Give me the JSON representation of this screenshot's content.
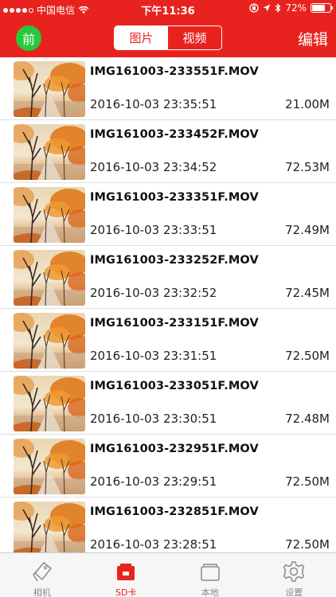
{
  "status_bar": {
    "carrier": "中国电信",
    "time": "下午11:36",
    "battery": "72%",
    "battery_level": 0.72
  },
  "nav": {
    "front_label": "前",
    "segments": [
      {
        "label": "图片",
        "active": true
      },
      {
        "label": "视频",
        "active": false
      }
    ],
    "edit_label": "编辑"
  },
  "files": [
    {
      "name": "IMG161003-233551F.MOV",
      "datetime": "2016-10-03 23:35:51",
      "size": "21.00M"
    },
    {
      "name": "IMG161003-233452F.MOV",
      "datetime": "2016-10-03 23:34:52",
      "size": "72.53M"
    },
    {
      "name": "IMG161003-233351F.MOV",
      "datetime": "2016-10-03 23:33:51",
      "size": "72.49M"
    },
    {
      "name": "IMG161003-233252F.MOV",
      "datetime": "2016-10-03 23:32:52",
      "size": "72.45M"
    },
    {
      "name": "IMG161003-233151F.MOV",
      "datetime": "2016-10-03 23:31:51",
      "size": "72.50M"
    },
    {
      "name": "IMG161003-233051F.MOV",
      "datetime": "2016-10-03 23:30:51",
      "size": "72.48M"
    },
    {
      "name": "IMG161003-232951F.MOV",
      "datetime": "2016-10-03 23:29:51",
      "size": "72.50M"
    },
    {
      "name": "IMG161003-232851F.MOV",
      "datetime": "2016-10-03 23:28:51",
      "size": "72.50M"
    }
  ],
  "tabs": [
    {
      "label": "相机",
      "icon": "camera-tag-icon",
      "active": false
    },
    {
      "label": "SD卡",
      "icon": "sd-card-icon",
      "active": true
    },
    {
      "label": "本地",
      "icon": "folder-icon",
      "active": false
    },
    {
      "label": "设置",
      "icon": "gear-icon",
      "active": false
    }
  ],
  "colors": {
    "brand_red": "#e8231f",
    "front_green": "#28c83a",
    "tab_inactive": "#8a8a8a"
  }
}
